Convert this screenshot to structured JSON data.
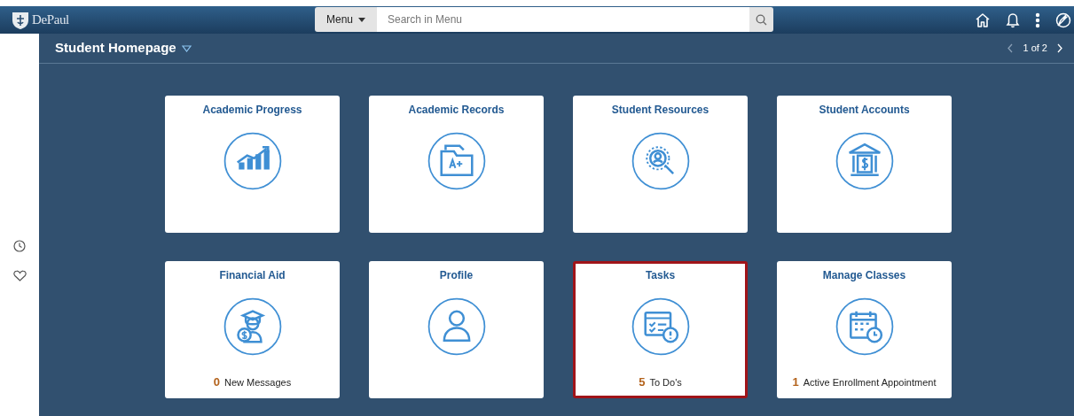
{
  "header": {
    "logo": "DePaul",
    "menu_button": "Menu",
    "search": {
      "placeholder": "Search in Menu"
    }
  },
  "page": {
    "title": "Student Homepage",
    "pager": "1 of 2"
  },
  "tiles": [
    {
      "title": "Academic Progress",
      "selected": false
    },
    {
      "title": "Academic Records",
      "selected": false
    },
    {
      "title": "Student Resources",
      "selected": false
    },
    {
      "title": "Student Accounts",
      "selected": false
    },
    {
      "title": "Financial Aid",
      "selected": false,
      "count": "0",
      "note": "New Messages"
    },
    {
      "title": "Profile",
      "selected": false
    },
    {
      "title": "Tasks",
      "selected": true,
      "count": "5",
      "note": "To Do's"
    },
    {
      "title": "Manage Classes",
      "selected": false,
      "count": "1",
      "note": "Active Enrollment Appointment"
    }
  ]
}
